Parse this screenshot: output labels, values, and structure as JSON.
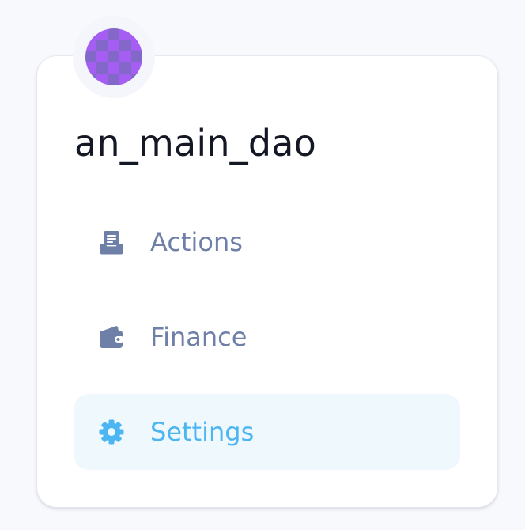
{
  "dao": {
    "name": "an_main_dao",
    "avatar_colors": {
      "primary": "#a55ef2",
      "secondary": "#8367c9"
    }
  },
  "nav": {
    "items": [
      {
        "label": "Actions",
        "icon": "inbox-document-icon",
        "active": false
      },
      {
        "label": "Finance",
        "icon": "wallet-icon",
        "active": false
      },
      {
        "label": "Settings",
        "icon": "gear-icon",
        "active": true
      }
    ]
  },
  "colors": {
    "inactive": "#6e7fa8",
    "active": "#4cb6f3",
    "active_bg": "#eff8fd"
  }
}
